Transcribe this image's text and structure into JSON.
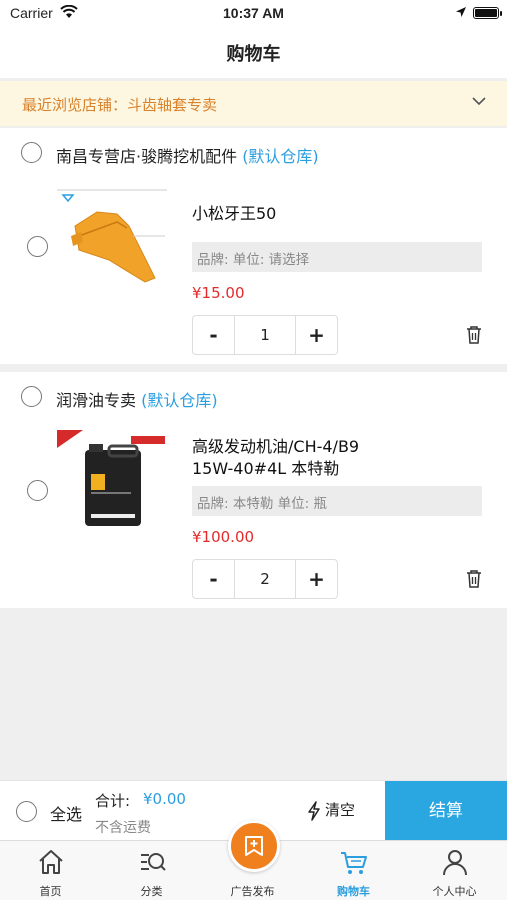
{
  "status_bar": {
    "carrier": "Carrier",
    "time": "10:37 AM"
  },
  "header": {
    "title": "购物车"
  },
  "recent_store": {
    "text": "最近浏览店铺：斗齿轴套专卖"
  },
  "stores": [
    {
      "name": "南昌专营店·骏腾挖机配件",
      "warehouse": "(默认仓库)",
      "items": [
        {
          "name": "小松牙王50",
          "spec": "品牌:    单位: 请选择",
          "price": "¥15.00",
          "qty": "1"
        }
      ]
    },
    {
      "name": "润滑油专卖",
      "warehouse": "(默认仓库)",
      "items": [
        {
          "name": "高级发动机油/CH-4/B9 15W-40#4L 本特勒",
          "spec": "品牌: 本特勒    单位: 瓶",
          "price": "¥100.00",
          "qty": "2"
        }
      ]
    }
  ],
  "stepper": {
    "minus": "-",
    "plus": "+"
  },
  "bottom_bar": {
    "select_all": "全选",
    "total_label": "合计:",
    "total_value": "¥0.00",
    "shipping_note": "不含运费",
    "clear_label": "清空",
    "checkout_label": "结算"
  },
  "tabbar": {
    "items": [
      {
        "label": "首页",
        "icon": "home-icon"
      },
      {
        "label": "分类",
        "icon": "category-search-icon"
      },
      {
        "label": "广告发布",
        "icon": "publish-icon"
      },
      {
        "label": "购物车",
        "icon": "cart-icon",
        "active": true
      },
      {
        "label": "个人中心",
        "icon": "person-icon"
      }
    ]
  },
  "colors": {
    "accent": "#2b9ee0",
    "price": "#e32b2b",
    "orange": "#f07f1e",
    "banner_text": "#d9822b",
    "banner_bg": "#fdf6e0"
  }
}
